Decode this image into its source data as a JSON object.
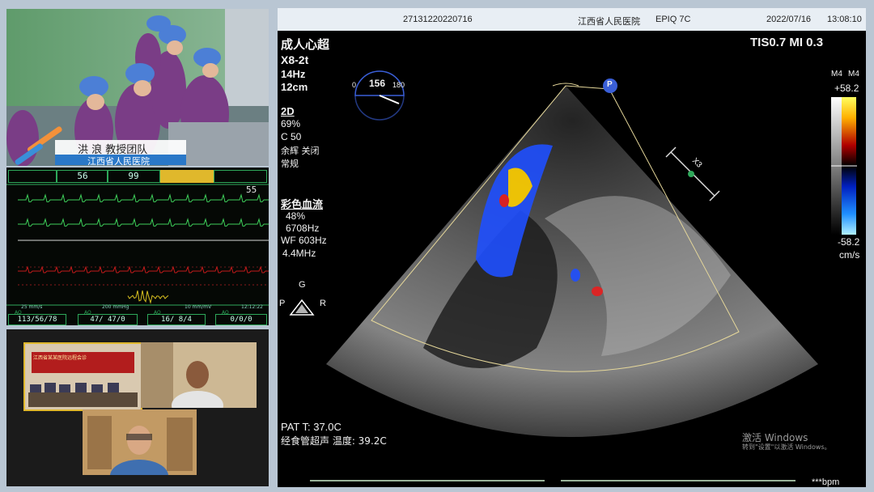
{
  "surgery_overlay": {
    "names": "洪 浪   教授团队",
    "hospital": "江西省人民医院"
  },
  "monitor": {
    "top_values": [
      "56",
      "99",
      "",
      ""
    ],
    "hr_value": "55",
    "scale_left": "25 mm/s",
    "scale_mid": "200 mmHg",
    "scale_right": "10 mm/mV",
    "time": "12:12:22",
    "bottom_labels": [
      "AO",
      "AO",
      "AO",
      "AO"
    ],
    "bottom_values": [
      "113/56/78",
      "47/ 47/0",
      "16/ 8/4",
      "0/0/0"
    ]
  },
  "meeting": {
    "tile1_caption": "江西省某某医院远程会诊",
    "tile2_caption": "",
    "tile3_caption": ""
  },
  "ultrasound": {
    "header_id": "27131220220716",
    "header_hospital": "江西省人民医院",
    "header_model": "EPIQ 7C",
    "header_date": "2022/07/16",
    "header_time": "13:08:10",
    "mode_title": "成人心超",
    "probe": "X8-2t",
    "frame_rate": "14Hz",
    "depth": "12cm",
    "tis_mi": "TIS0.7   MI 0.3",
    "angle_min": "0",
    "angle_value": "156",
    "angle_max": "180",
    "param_2d_title": "2D",
    "param_2d_gain": "69%",
    "param_2d_c": "C 50",
    "param_2d_line3": "余辉 关闭",
    "param_2d_line4": "常规",
    "color_title": "彩色血流",
    "color_gain": "48%",
    "color_prf": "6708Hz",
    "color_wf": "WF 603Hz",
    "color_freq": "4.4MHz",
    "scale_label_left": "M4",
    "scale_label_right": "M4",
    "scale_max": "+58.2",
    "scale_min": "-58.2",
    "scale_unit": "cm/s",
    "orientation_g": "G",
    "orientation_p": "P",
    "orientation_r": "R",
    "marker_p": "P",
    "x3_label": "X3",
    "pat_temp": "PAT T: 37.0C",
    "tee_temp": "经食管超声 温度: 39.2C",
    "bpm": "***bpm",
    "watermark_1": "激活 Windows",
    "watermark_2": "转到\"设置\"以激活 Windows。"
  },
  "colors": {
    "background": "#b9c6d3",
    "accent_orange": "#f3913a",
    "monitor_green": "#2ea85a",
    "ecg_green": "#3ecf5a",
    "doppler_red": "#e81e1e",
    "doppler_blue": "#1f4fff"
  }
}
